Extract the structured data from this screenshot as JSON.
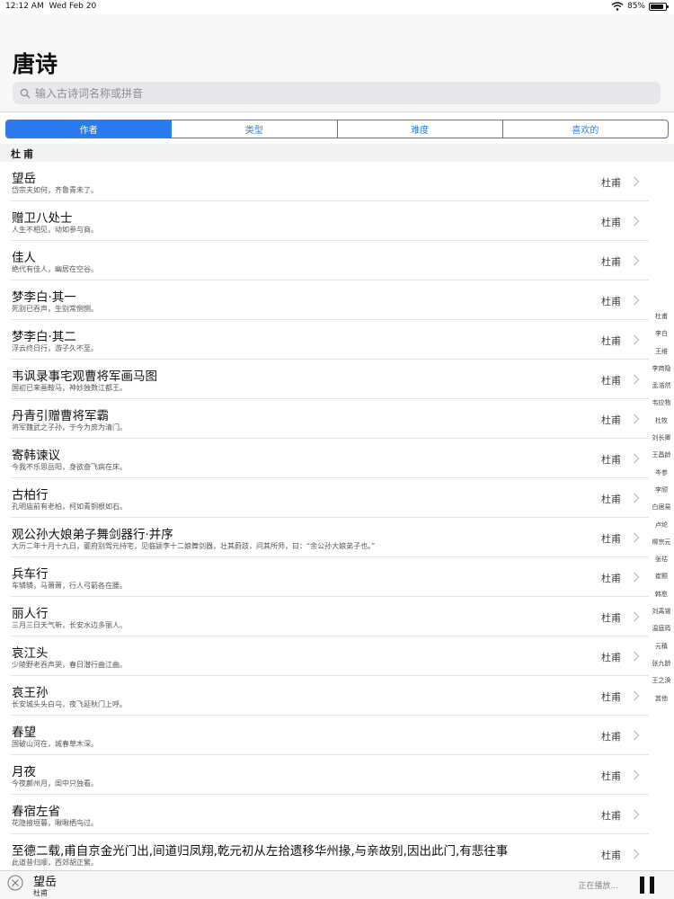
{
  "status": {
    "time": "12:12 AM",
    "date": "Wed Feb 20",
    "battery": "85%",
    "battery_level": 0.85
  },
  "header": {
    "title": "唐诗",
    "search_placeholder": "输入古诗词名称或拼音"
  },
  "tabs": [
    {
      "label": "作者",
      "active": true
    },
    {
      "label": "类型",
      "active": false
    },
    {
      "label": "难度",
      "active": false
    },
    {
      "label": "喜欢的",
      "active": false
    }
  ],
  "section": {
    "title": "杜甫"
  },
  "poems": [
    {
      "title": "望岳",
      "subtitle": "岱宗夫如何，齐鲁青未了。",
      "author": "杜甫"
    },
    {
      "title": "赠卫八处士",
      "subtitle": "人生不相见，动如参与商。",
      "author": "杜甫"
    },
    {
      "title": "佳人",
      "subtitle": "绝代有佳人，幽居在空谷。",
      "author": "杜甫"
    },
    {
      "title": "梦李白·其一",
      "subtitle": "死别已吞声，生别常恻恻。",
      "author": "杜甫"
    },
    {
      "title": "梦李白·其二",
      "subtitle": "浮云终日行，游子久不至。",
      "author": "杜甫"
    },
    {
      "title": "韦讽录事宅观曹将军画马图",
      "subtitle": "国初已来画鞍马，神妙独数江都王。",
      "author": "杜甫"
    },
    {
      "title": "丹青引赠曹将军霸",
      "subtitle": "将军魏武之子孙，于今为庶为清门。",
      "author": "杜甫"
    },
    {
      "title": "寄韩谏议",
      "subtitle": "今我不乐思岳阳，身欲奋飞病在床。",
      "author": "杜甫"
    },
    {
      "title": "古柏行",
      "subtitle": "孔明庙前有老柏，柯如青铜根如石。",
      "author": "杜甫"
    },
    {
      "title": "观公孙大娘弟子舞剑器行·并序",
      "subtitle": "大历二年十月十九日，夔府别驾元持宅，见临颍李十二娘舞剑器，壮其蔚跂，问其所师，曰：“余公孙大娘弟子也。”",
      "author": "杜甫"
    },
    {
      "title": "兵车行",
      "subtitle": "车辚辚，马萧萧，行人弓箭各在腰。",
      "author": "杜甫"
    },
    {
      "title": "丽人行",
      "subtitle": "三月三日天气新，长安水边多丽人。",
      "author": "杜甫"
    },
    {
      "title": "哀江头",
      "subtitle": "少陵野老吞声哭，春日潜行曲江曲。",
      "author": "杜甫"
    },
    {
      "title": "哀王孙",
      "subtitle": "长安城头头白乌，夜飞延秋门上呼。",
      "author": "杜甫"
    },
    {
      "title": "春望",
      "subtitle": "国破山河在，城春草木深。",
      "author": "杜甫"
    },
    {
      "title": "月夜",
      "subtitle": "今夜鄜州月，闺中只独看。",
      "author": "杜甫"
    },
    {
      "title": "春宿左省",
      "subtitle": "花隐掖垣暮，啾啾栖鸟过。",
      "author": "杜甫"
    },
    {
      "title": "至德二载,甫自京金光门出,间道归凤翔,乾元初从左拾遗移华州掾,与亲故别,因出此门,有悲往事",
      "subtitle": "此道昔归顺，西郊胡正繁。",
      "author": "杜甫"
    }
  ],
  "index": [
    "杜甫",
    "李白",
    "王维",
    "李商隐",
    "孟浩然",
    "韦应物",
    "杜牧",
    "刘长卿",
    "王昌龄",
    "岑参",
    "李颀",
    "白居易",
    "卢纶",
    "柳宗元",
    "张祜",
    "崔颢",
    "韩愈",
    "刘禹锡",
    "温庭筠",
    "元稹",
    "张九龄",
    "王之涣",
    "其他"
  ],
  "player": {
    "title": "望岳",
    "author": "杜甫",
    "status": "正在播放..."
  },
  "colors": {
    "accent": "#2a7bf0"
  }
}
